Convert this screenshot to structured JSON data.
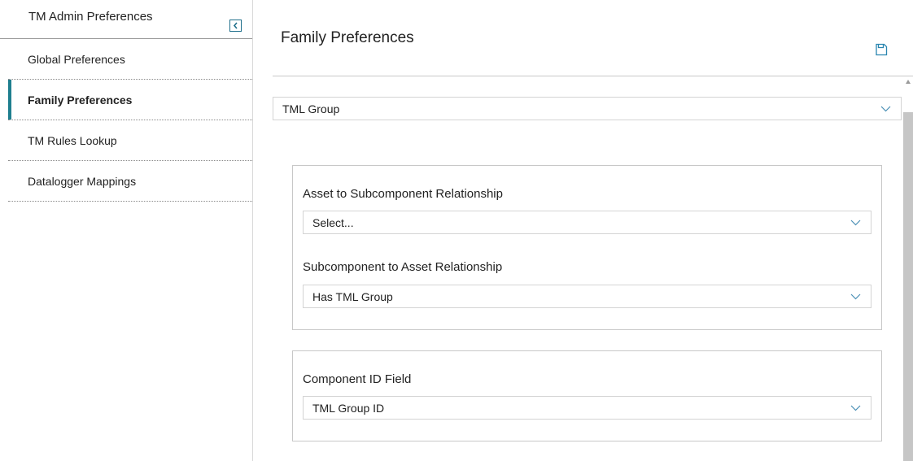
{
  "sidebar": {
    "title": "TM Admin Preferences",
    "items": [
      {
        "label": "Global Preferences",
        "active": false
      },
      {
        "label": "Family Preferences",
        "active": true
      },
      {
        "label": "TM Rules Lookup",
        "active": false
      },
      {
        "label": "Datalogger Mappings",
        "active": false
      }
    ]
  },
  "main": {
    "title": "Family Preferences",
    "family_select": {
      "value": "TML Group"
    },
    "relationships": {
      "asset_to_sub_label": "Asset to Subcomponent Relationship",
      "asset_to_sub_value": "Select...",
      "sub_to_asset_label": "Subcomponent to Asset Relationship",
      "sub_to_asset_value": "Has TML Group"
    },
    "component": {
      "label": "Component ID Field",
      "value": "TML Group ID"
    }
  },
  "icons": {
    "collapse": "chevron-left-icon",
    "save": "save-icon",
    "dropdown": "chevron-down-icon"
  },
  "colors": {
    "accent": "#1f7f8f",
    "save_icon": "#2a86b0",
    "chevron": "#4a8fb5"
  }
}
